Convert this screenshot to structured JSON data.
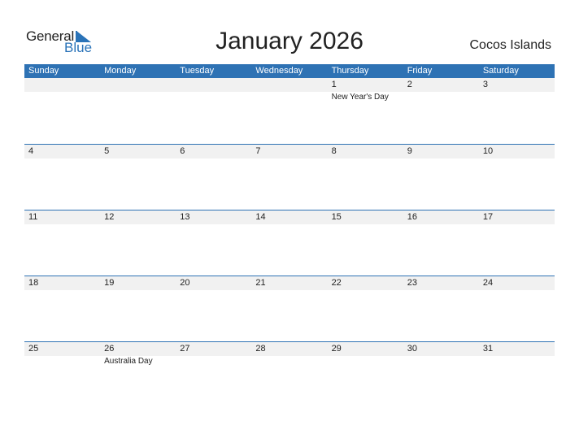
{
  "logo": {
    "text1": "General",
    "text2": "Blue"
  },
  "title": "January 2026",
  "country": "Cocos Islands",
  "colors": {
    "accent": "#2e72b4",
    "strip": "#f1f1f1"
  },
  "weekdays": [
    "Sunday",
    "Monday",
    "Tuesday",
    "Wednesday",
    "Thursday",
    "Friday",
    "Saturday"
  ],
  "weeks": [
    {
      "days": [
        "",
        "",
        "",
        "",
        "1",
        "2",
        "3"
      ],
      "events": [
        "",
        "",
        "",
        "",
        "New Year's Day",
        "",
        ""
      ]
    },
    {
      "days": [
        "4",
        "5",
        "6",
        "7",
        "8",
        "9",
        "10"
      ],
      "events": [
        "",
        "",
        "",
        "",
        "",
        "",
        ""
      ]
    },
    {
      "days": [
        "11",
        "12",
        "13",
        "14",
        "15",
        "16",
        "17"
      ],
      "events": [
        "",
        "",
        "",
        "",
        "",
        "",
        ""
      ]
    },
    {
      "days": [
        "18",
        "19",
        "20",
        "21",
        "22",
        "23",
        "24"
      ],
      "events": [
        "",
        "",
        "",
        "",
        "",
        "",
        ""
      ]
    },
    {
      "days": [
        "25",
        "26",
        "27",
        "28",
        "29",
        "30",
        "31"
      ],
      "events": [
        "",
        "Australia Day",
        "",
        "",
        "",
        "",
        ""
      ]
    }
  ]
}
